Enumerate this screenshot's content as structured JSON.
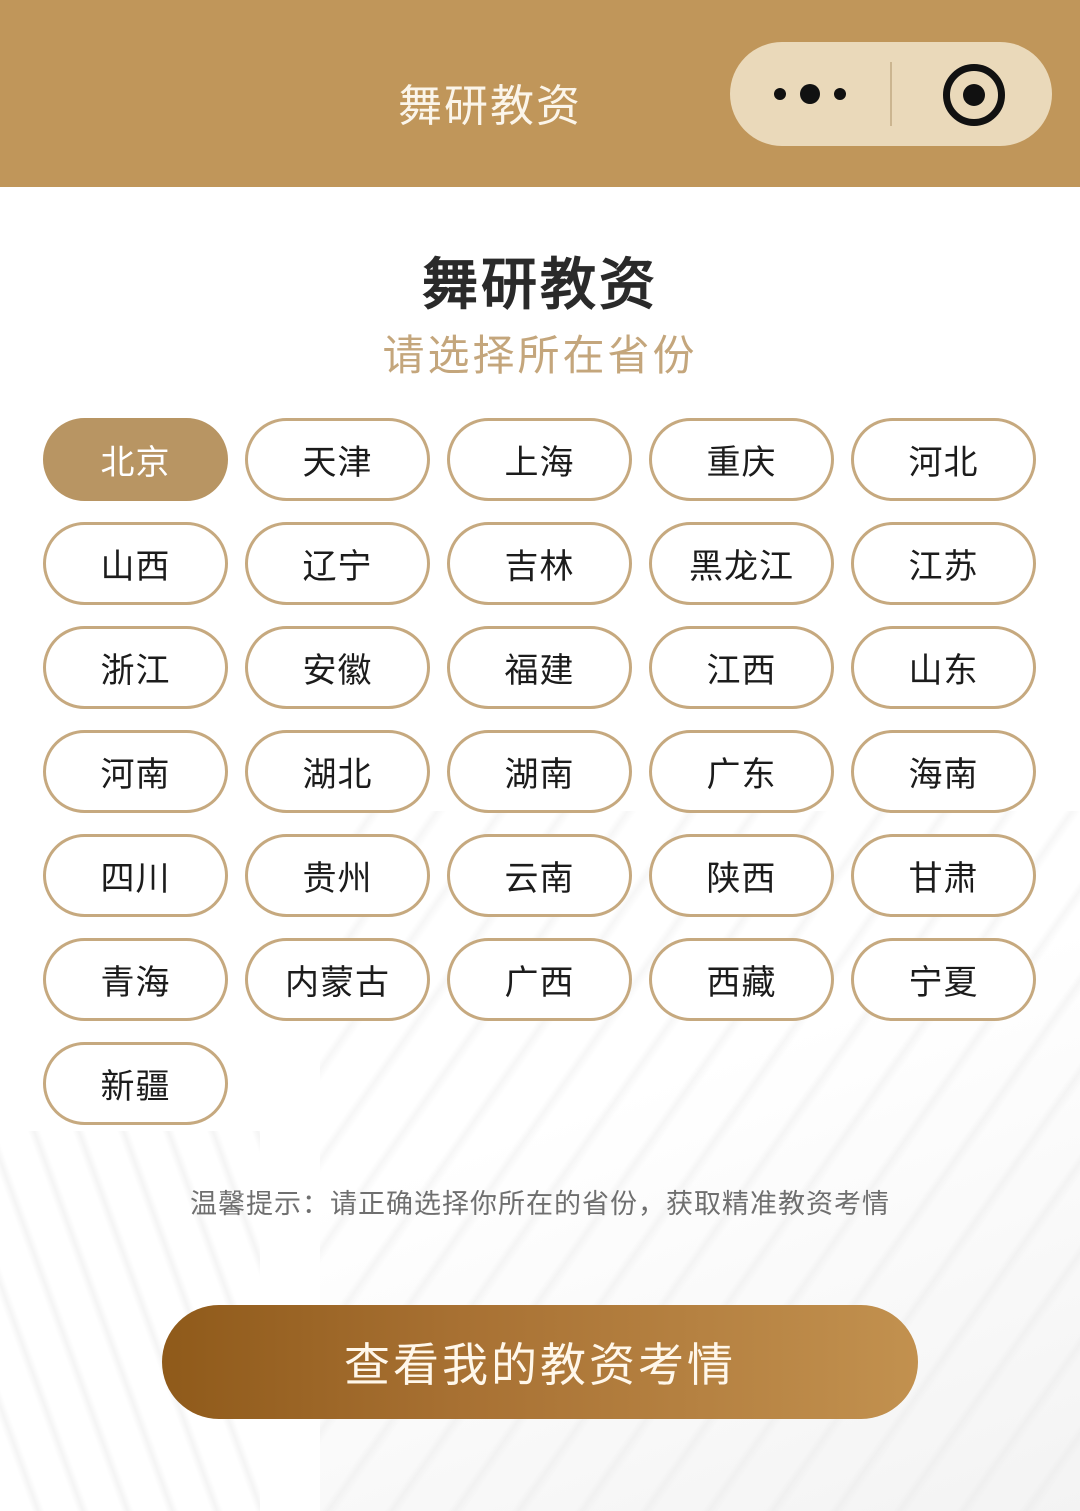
{
  "header": {
    "title": "舞研教资"
  },
  "capsule": {
    "more_icon": "more-dots-icon",
    "close_icon": "target-circle-icon"
  },
  "main": {
    "title": "舞研教资",
    "subtitle": "请选择所在省份"
  },
  "provinces": {
    "selected_index": 0,
    "items": [
      "北京",
      "天津",
      "上海",
      "重庆",
      "河北",
      "山西",
      "辽宁",
      "吉林",
      "黑龙江",
      "江苏",
      "浙江",
      "安徽",
      "福建",
      "江西",
      "山东",
      "河南",
      "湖北",
      "湖南",
      "广东",
      "海南",
      "四川",
      "贵州",
      "云南",
      "陕西",
      "甘肃",
      "青海",
      "内蒙古",
      "广西",
      "西藏",
      "宁夏",
      "新疆"
    ]
  },
  "tip": "温馨提示：请正确选择你所在的省份，获取精准教资考情",
  "cta": {
    "label": "查看我的教资考情"
  },
  "colors": {
    "header_bg": "#c0965a",
    "accent": "#b89563",
    "border": "#c6a97f",
    "subtitle": "#c4a67c",
    "button_start": "#8f5a1a",
    "button_end": "#c2914f"
  }
}
